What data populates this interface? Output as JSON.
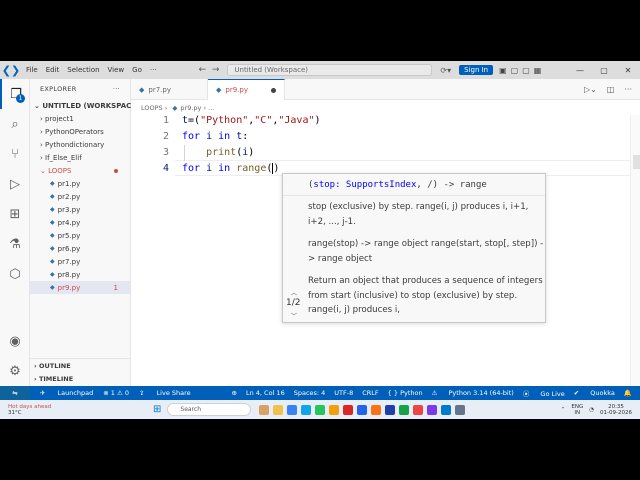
{
  "titlebar": {
    "menu": [
      "File",
      "Edit",
      "Selection",
      "View",
      "Go"
    ],
    "menu_more": "···",
    "search_text": "Untitled (Workspace)",
    "signin_label": "Sign In"
  },
  "activity": {
    "explorer_badge": "1"
  },
  "sidebar": {
    "header": "EXPLORER",
    "header_more": "···",
    "workspace": "UNTITLED (WORKSPACE)",
    "folders": [
      "project1",
      "PythonOPerators",
      "Pythondictionary",
      "If_Else_Elif"
    ],
    "loops_folder": "LOOPS",
    "files": [
      "pr1.py",
      "pr2.py",
      "pr3.py",
      "pr4.py",
      "pr5.py",
      "pr6.py",
      "pr7.py",
      "pr8.py",
      "pr9.py"
    ],
    "selected_file_errors": "1",
    "outline": "OUTLINE",
    "timeline": "TIMELINE"
  },
  "tabs": [
    {
      "label": "pr7.py",
      "active": false
    },
    {
      "label": "pr9.py",
      "active": true
    }
  ],
  "breadcrumb": {
    "folder": "LOOPS",
    "file": "pr9.py",
    "tail": "...",
    "error_count": "1"
  },
  "editor": {
    "line_numbers": [
      "1",
      "2",
      "3",
      "4"
    ]
  },
  "hover": {
    "signature_open": "(",
    "signature_param": "stop: SupportsIndex",
    "signature_rest": ", /) -> range",
    "para1": "stop (exclusive) by step. range(i, j) produces i, i+1, i+2, ..., j-1.",
    "para2": "range(stop) -> range object range(start, stop[, step]) -> range object",
    "para3": "Return an object that produces a sequence of integers from start (inclusive) to stop (exclusive) by step. range(i, j) produces i,",
    "counter": "1/2"
  },
  "statusbar": {
    "launchpad": "Launchpad",
    "problems": "⊗ 1 ⚠ 0",
    "liveshare": "Live Share",
    "position": "Ln 4, Col 16",
    "spaces": "Spaces: 4",
    "encoding": "UTF-8",
    "eol": "CRLF",
    "language": "{ } Python",
    "interpreter": "Python 3.14 (64-bit)",
    "golive": "Go Live",
    "quokka": "Quokka"
  },
  "taskbar": {
    "weather_line1": "Hot days ahead",
    "weather_line2": "31°C",
    "search_placeholder": "Search",
    "lang_line1": "ENG",
    "lang_line2": "IN",
    "time": "20:35",
    "date": "01-09-2026"
  },
  "colors": {
    "accent": "#005fb8",
    "error": "#c84d4d",
    "keyword": "#0000ff",
    "string": "#a31515"
  }
}
